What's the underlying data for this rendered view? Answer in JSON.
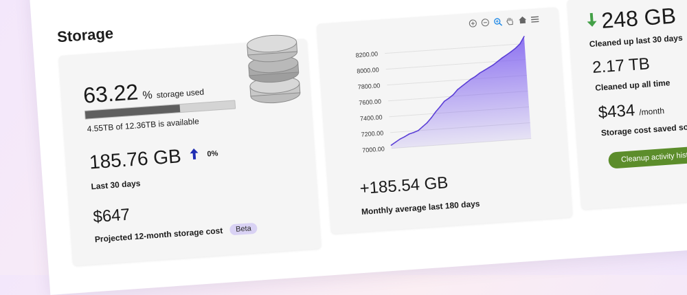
{
  "page": {
    "title": "Storage"
  },
  "usage_card": {
    "percent_value": "63.22",
    "percent_symbol": "%",
    "percent_label": "storage used",
    "progress": 0.6322,
    "availability_text": "4.55TB of 12.36TB is available",
    "recent_value": "185.76 GB",
    "recent_change": "0%",
    "recent_label": "Last 30 days",
    "cost_value": "$647",
    "cost_label": "Projected 12-month storage cost",
    "cost_badge": "Beta"
  },
  "trend_card": {
    "toolbar_icons": [
      "zoom-in-icon",
      "zoom-out-icon",
      "zoom-select-icon",
      "pan-hand-icon",
      "home-icon",
      "menu-icon"
    ],
    "summary_value": "+185.54 GB",
    "summary_label": "Monthly average last 180 days"
  },
  "chart_data": {
    "type": "area",
    "ylim": [
      7000,
      8300
    ],
    "yticks": [
      "8200.00",
      "8000.00",
      "7800.00",
      "7600.00",
      "7400.00",
      "7200.00",
      "7000.00"
    ],
    "values": [
      7040,
      7075,
      7110,
      7135,
      7165,
      7180,
      7200,
      7245,
      7290,
      7350,
      7420,
      7480,
      7545,
      7580,
      7620,
      7680,
      7720,
      7760,
      7800,
      7830,
      7870,
      7900,
      7930,
      7960,
      8000,
      8040,
      8075,
      8110,
      8150,
      8200,
      8290
    ],
    "grid": true,
    "color": "#7b5cf0"
  },
  "cleanup_card": {
    "last30_value": "248 GB",
    "last30_label": "Cleaned up last 30 days",
    "alltime_value": "2.17 TB",
    "alltime_label": "Cleaned up all time",
    "saved_value": "$434",
    "saved_unit": "/month",
    "saved_label": "Storage cost saved so far",
    "button_label": "Cleanup activity history"
  },
  "colors": {
    "down_arrow": "#43a047",
    "up_arrow": "#1f2db3",
    "progress_fill": "#5f5f5f",
    "button_bg": "#5c8d2b",
    "badge_bg": "#d9d2f4"
  }
}
